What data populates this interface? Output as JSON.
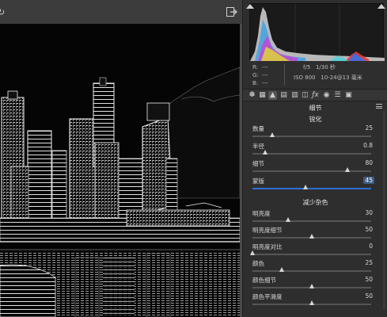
{
  "histogram": {
    "readout": {
      "r_label": "R:",
      "r_value": "---",
      "g_label": "G:",
      "g_value": "---",
      "b_label": "B:",
      "b_value": "---"
    },
    "exif": {
      "aperture": "f/5",
      "shutter": "1/30 秒",
      "iso": "ISO 800",
      "lens": "10-24@13 毫米"
    }
  },
  "panel": {
    "header": "细节",
    "sharpen": {
      "title": "锐化",
      "sliders": [
        {
          "label": "数量",
          "value": "25",
          "level": 0.17
        },
        {
          "label": "半径",
          "value": "0.8",
          "level": 0.11
        },
        {
          "label": "细节",
          "value": "80",
          "level": 0.8
        },
        {
          "label": "蒙版",
          "value": "45",
          "level": 0.45,
          "active": true
        }
      ]
    },
    "noise": {
      "title": "减少杂色",
      "sliders": [
        {
          "label": "明亮度",
          "value": "30",
          "level": 0.3
        },
        {
          "label": "明亮度细节",
          "value": "50",
          "level": 0.5
        },
        {
          "label": "明亮度对比",
          "value": "0",
          "level": 0.0
        },
        {
          "label": "颜色",
          "value": "25",
          "level": 0.25
        },
        {
          "label": "颜色细节",
          "value": "50",
          "level": 0.5
        },
        {
          "label": "颜色平滑度",
          "value": "50",
          "level": 0.5
        }
      ]
    }
  },
  "toolbar_icons": [
    "basic-icon",
    "tone-curve-icon",
    "detail-icon",
    "hsl-icon",
    "split-toning-icon",
    "lens-corrections-icon",
    "fx-icon",
    "camera-calibration-icon",
    "presets-icon",
    "snapshots-icon"
  ],
  "colors": {
    "accent": "#2d6fd1",
    "panel_bg": "#2e2e2e",
    "preview_bg": "#050505"
  }
}
